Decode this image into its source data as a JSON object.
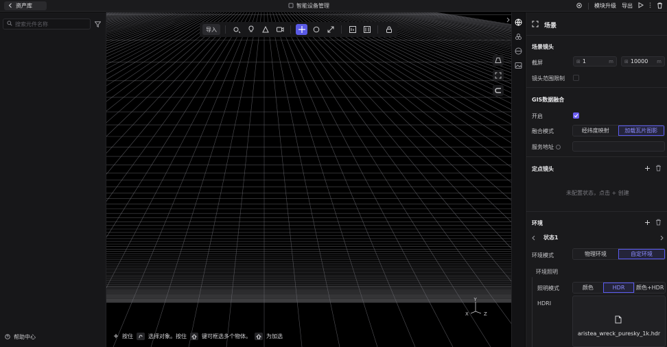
{
  "topbar": {
    "back_label": "资产库",
    "title": "智能设备管理",
    "upgrade_label": "模块升级",
    "export_label": "导出"
  },
  "sidebar": {
    "search_placeholder": "搜索元件名称",
    "help_label": "帮助中心"
  },
  "toolbar": {
    "import_label": "导入",
    "active_tool": "move-icon"
  },
  "hint": {
    "part1": "按住",
    "part2": "选择对象。按住",
    "part3": "键可框选多个物体。",
    "part4": "为加选"
  },
  "axis": {
    "y": "Y",
    "x": "X",
    "z": "Z"
  },
  "panel": {
    "title": "场景",
    "camera": {
      "title": "场景镜头",
      "clip_label": "截屏",
      "near_value": "1",
      "far_value": "10000",
      "unit": "m",
      "collision_label": "镜头范围限制",
      "collision_checked": false
    },
    "gis": {
      "title": "GIS数据融合",
      "enable_label": "开启",
      "enabled": true,
      "mode_label": "融合模式",
      "mode_options": [
        "经纬度映射",
        "加载瓦片图影"
      ],
      "mode_selected": 1,
      "service_label": "服务地址"
    },
    "fixed_camera": {
      "title": "定点镜头",
      "empty_text": "未配置状态，点击 + 创建"
    },
    "environment": {
      "title": "环境",
      "state_name": "状态1",
      "mode_label": "环境模式",
      "mode_options": [
        "物理环境",
        "自定环境"
      ],
      "mode_selected": 1,
      "lighting_title": "环境照明",
      "light_mode_label": "照明模式",
      "light_options": [
        "颜色",
        "HDR",
        "颜色+HDR"
      ],
      "light_selected": 1,
      "hdri_label": "HDRI",
      "hdri_file": "aristea_wreck_puresky_1k.hdr"
    }
  },
  "colors": {
    "accent": "#5b5bf0",
    "grid": "#6e6e74"
  }
}
